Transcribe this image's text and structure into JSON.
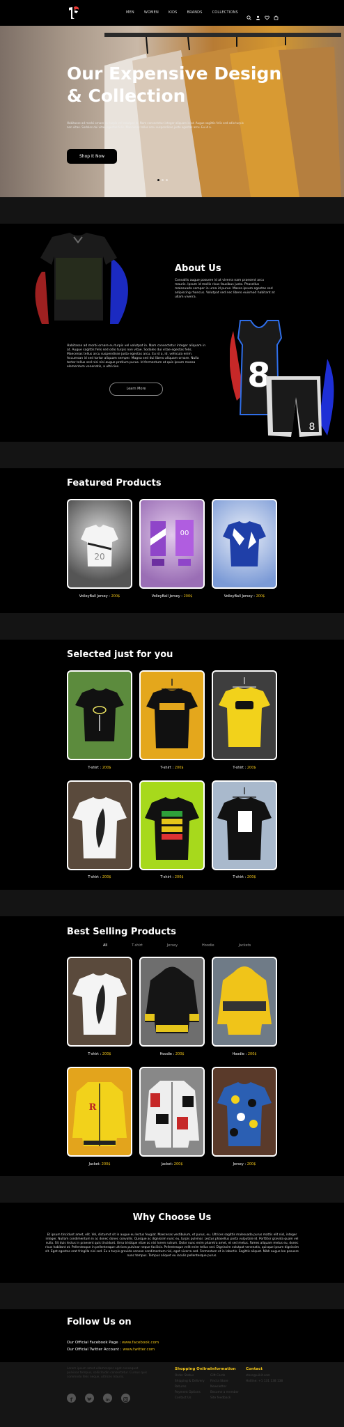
{
  "nav": {
    "links": [
      "MEN",
      "WOMEN",
      "KIDS",
      "BRANDS",
      "COLLECTIONS"
    ],
    "icons": [
      "search-icon",
      "user-icon",
      "heart-icon",
      "cart-icon"
    ]
  },
  "hero": {
    "title": "Our Expensive Design & Collection",
    "text": "Habitasse ad morbi ornare eu turpis vel volutpat in. Nam consectetur integer aliquam in at. Augue sagittis felis sed odio turpis non vitae. Sodales dui vitae egestas felis. Maecenas tellus arcu suspendisse justo egestas arcu. Eu id a.",
    "button": "Shop It Now"
  },
  "about": {
    "title": "About Us",
    "text1": "Convallis augue posuere id at viverra nam praesent arcu mauris. Ipsum id mollis risus faucibus justo. Phasellus malesuada semper in urna id purus. Massa ipsum egestas sed adipiscing rhoncus. Volutpat sed nec libero euismod habitant at ullam viverra.",
    "text2": "Habitasse ad morbi ornare eu turpis vel volutpat in. Nam consectetur integer aliquam in at. Augue sagittis felis sed odio turpis non vitae. Sodales dui vitae egestas felis. Maecenas tellus arcu suspendisse justo egestas arcu. Eu id a, id, vehicula enim. Accumsan id sed tortor aliquam semper. Magna sed dui libero aliquam ornare. Nulla tortor tellus sed nisi nisi augue pretium purus. Id fermentum at quis ipsum massa elementum venenatis, a ultricies.",
    "button": "Learn More"
  },
  "featured": {
    "title": "Featured Products",
    "items": [
      {
        "name": "VolleyBall Jersey : ",
        "price": "200$"
      },
      {
        "name": "VolleyBall Jersey : ",
        "price": "200$"
      },
      {
        "name": "VolleyBall Jersey : ",
        "price": "200$"
      }
    ]
  },
  "selected": {
    "title": "Selected just for you",
    "items": [
      {
        "name": "T-shirt : ",
        "price": "200$"
      },
      {
        "name": "T-shirt : ",
        "price": "200$"
      },
      {
        "name": "T-shirt : ",
        "price": "200$"
      },
      {
        "name": "T-shirt : ",
        "price": "200$"
      },
      {
        "name": "T-shirt : ",
        "price": "200$"
      },
      {
        "name": "T-shirt : ",
        "price": "200$"
      }
    ]
  },
  "bestselling": {
    "title": "Best Selling Products",
    "filters": [
      "All",
      "T-shirt",
      "Jersey",
      "Hoodie",
      "Jackets"
    ],
    "items": [
      {
        "name": "T-shirt : ",
        "price": "200$"
      },
      {
        "name": "Hoodie : ",
        "price": "200$"
      },
      {
        "name": "Hoodie : ",
        "price": "200$"
      },
      {
        "name": "Jacket: ",
        "price": "200$"
      },
      {
        "name": "Jacket: ",
        "price": "200$"
      },
      {
        "name": "Jersey : ",
        "price": "200$"
      }
    ]
  },
  "why": {
    "title": "Why Choose Us",
    "text": "Et ipsum tincidunt amet, elit. Vel, dictumst sit in augue eu lectus feugiat. Maecenas vestibulum, et purus, eu. Ultrices sagittis malesuada purus mattis elit nisl, integer integer. Nullam condimentum in ac donec donec convallis. Quisque ac dignissim nunc eu, turpis pulvinar. Lectus phasellus porta vulputate id. Porttitor gravida quam vel nulla. Sit duis lectus in praesent quis tincidunt. Urna tristique vitae ac nisi lorem rutrum. Dolor nunc enim pharetra amet, et sed metus. Fames aliquam metus eu, donec risus habitant at. Pellentesque in pellentesque ultrices pulvinar neque facilisis. Pellentesque velit enim tellus sed. Dignissim volutpat venenatis, quisque ipsum dignissim sit. Eget egestas erat fringilla nisi sed. Eu a turpis gravida senean condimentum nisi, eget viverra sed. Fermentum et in lobortis. Sagittis aliquet. Nibh augue leo posuere nunc tempus. Tempus aliquet eu iaculis pellentesque purus."
  },
  "follow": {
    "title": "Follow Us on",
    "facebook_label": "Our Official Facebook Page : ",
    "facebook_url": "www.facebook.com",
    "twitter_label": "Our Official Twitter Account : ",
    "twitter_url": "www.twitter.com"
  },
  "footer": {
    "about": "Lorem ipsum amet ullamcorper eget consequat pulvinar tempus, sollicitudin consectetur. Cursus quis commodo felis neque, ultrices mauris.",
    "columns": [
      {
        "title": "Shopping Online",
        "items": [
          "Order Status",
          "Shipping & Delivery",
          "Returns",
          "Payment Options",
          "Contact Us"
        ]
      },
      {
        "title": "Information",
        "items": [
          "Gift Cards",
          "Find a Store",
          "Newsletter",
          "Become a member",
          "Site feedback"
        ]
      },
      {
        "title": "Contact",
        "items": [
          "store@uikit.com",
          "Hotline: +1 131 138 138"
        ]
      }
    ],
    "social": [
      "facebook-icon",
      "twitter-icon",
      "linkedin-icon",
      "instagram-icon"
    ]
  },
  "colors": {
    "accent": "#f0c419",
    "background": "#000000",
    "separator": "#141414"
  }
}
